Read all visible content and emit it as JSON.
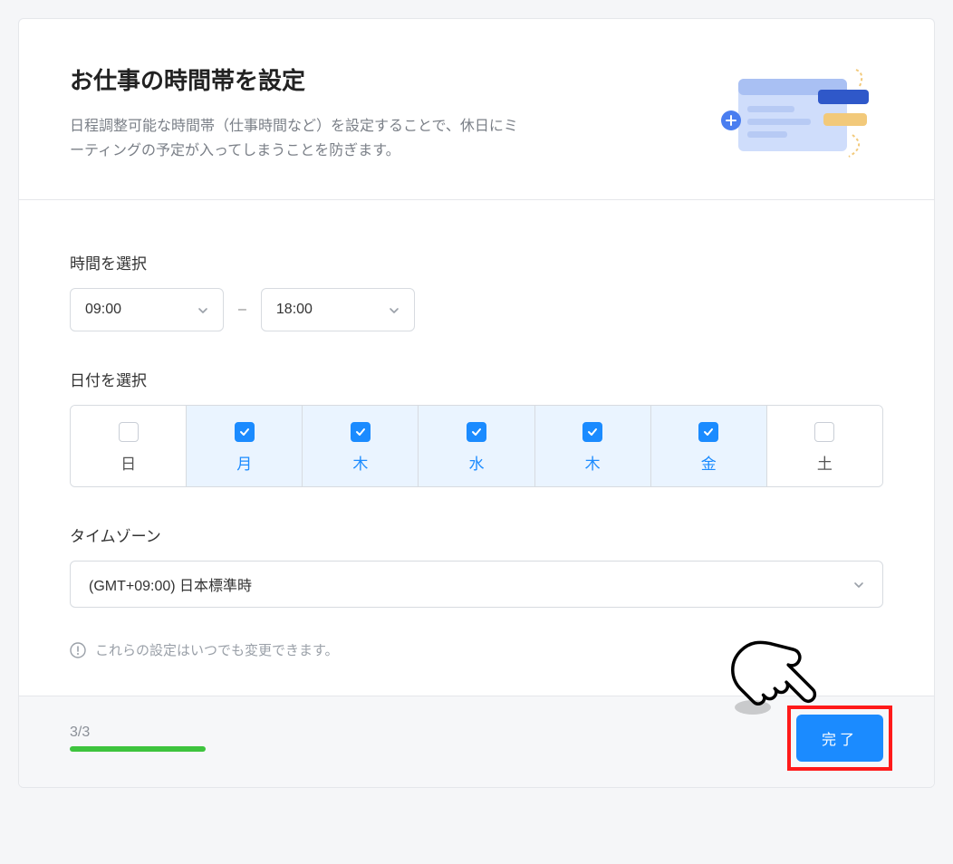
{
  "header": {
    "title": "お仕事の時間帯を設定",
    "subtitle": "日程調整可能な時間帯（仕事時間など）を設定することで、休日にミーティングの予定が入ってしまうことを防ぎます。"
  },
  "time": {
    "label": "時間を選択",
    "start": "09:00",
    "dash": "–",
    "end": "18:00"
  },
  "days": {
    "label": "日付を選択",
    "items": [
      {
        "label": "日",
        "checked": false
      },
      {
        "label": "月",
        "checked": true
      },
      {
        "label": "木",
        "checked": true
      },
      {
        "label": "水",
        "checked": true
      },
      {
        "label": "木",
        "checked": true
      },
      {
        "label": "金",
        "checked": true
      },
      {
        "label": "土",
        "checked": false
      }
    ]
  },
  "timezone": {
    "label": "タイムゾーン",
    "value": "(GMT+09:00) 日本標準時"
  },
  "info_text": "これらの設定はいつでも変更できます。",
  "footer": {
    "progress": "3/3",
    "done_label": "完了"
  }
}
